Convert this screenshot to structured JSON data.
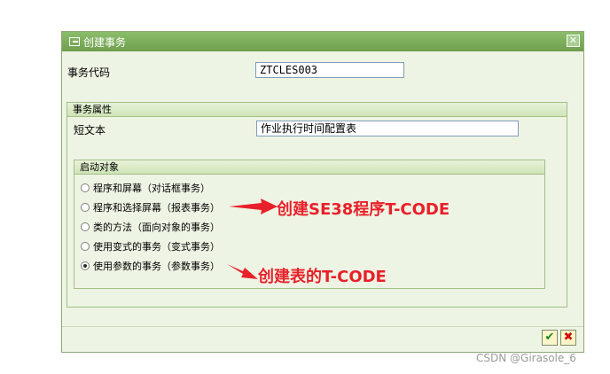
{
  "dialog": {
    "title": "创建事务",
    "close_icon_label": "✕"
  },
  "transaction_code": {
    "label": "事务代码",
    "value": "ZTCLES003"
  },
  "attributes": {
    "header": "事务属性",
    "short_text_label": "短文本",
    "short_text_value": "作业执行时间配置表"
  },
  "start_object": {
    "header": "启动对象",
    "options": [
      {
        "label": "程序和屏幕（对话框事务）",
        "checked": false
      },
      {
        "label": "程序和选择屏幕（报表事务）",
        "checked": false
      },
      {
        "label": "类的方法（面向对象的事务）",
        "checked": false
      },
      {
        "label": "使用变式的事务（变式事务）",
        "checked": false
      },
      {
        "label": "使用参数的事务（参数事务）",
        "checked": true
      }
    ]
  },
  "annotations": {
    "note1": "创建SE38程序T-CODE",
    "note2": "创建表的T-CODE"
  },
  "footer": {
    "ok_symbol": "✔",
    "cancel_symbol": "✖"
  },
  "watermark": "CSDN @Girasole_6"
}
